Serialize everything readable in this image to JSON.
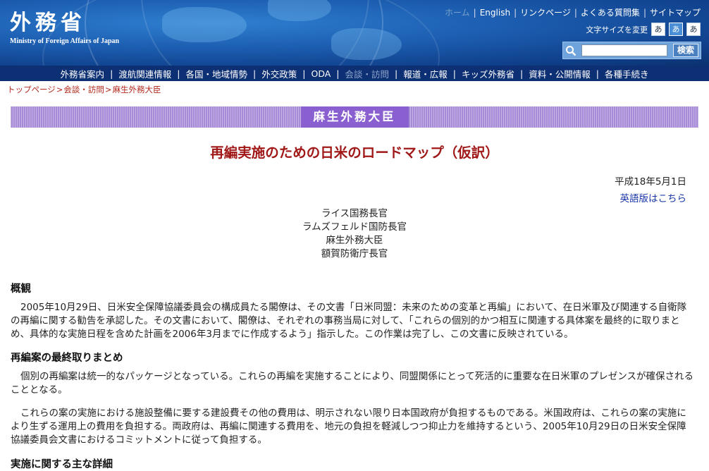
{
  "header": {
    "logo_ja": "外務省",
    "logo_en": "Ministry of Foreign Affairs of Japan",
    "util_links": [
      "English",
      "リンクページ",
      "よくある質問集",
      "サイトマップ"
    ],
    "util_dim": "ホーム",
    "font_size_label": "文字サイズを変更",
    "font_sizes": [
      "あ",
      "あ",
      "あ"
    ],
    "search_placeholder": "",
    "search_button": "検索"
  },
  "nav": {
    "items": [
      "外務省案内",
      "渡航関連情報",
      "各国・地域情勢",
      "外交政策",
      "ODA",
      "会談・訪問",
      "報道・広報",
      "キッズ外務省",
      "資料・公開情報",
      "各種手続き"
    ],
    "current_index": 5
  },
  "breadcrumb": [
    "トップページ",
    "会談・訪問",
    "麻生外務大臣"
  ],
  "section_title": "麻生外務大臣",
  "document": {
    "title": "再編実施のための日米のロードマップ（仮訳）",
    "date": "平成18年5月1日",
    "english_link": "英語版はこちら",
    "signatories": [
      "ライス国務長官",
      "ラムズフェルド国防長官",
      "麻生外務大臣",
      "額賀防衛庁長官"
    ],
    "h_overview": "概観",
    "p_overview": "2005年10月29日、日米安全保障協議委員会の構成員たる閣僚は、その文書「日米同盟：未来のための変革と再編」において、在日米軍及び関連する自衛隊の再編に関する勧告を承認した。その文書において、閣僚は、それぞれの事務当局に対して、「これらの個別的かつ相互に関連する具体案を最終的に取りまとめ、具体的な実施日程を含めた計画を2006年3月までに作成するよう」指示した。この作業は完了し、この文書に反映されている。",
    "h_final": "再編案の最終取りまとめ",
    "p_final_1": "個別の再編案は統一的なパッケージとなっている。これらの再編を実施することにより、同盟関係にとって死活的に重要な在日米軍のプレゼンスが確保されることとなる。",
    "p_final_2": "これらの案の実施における施設整備に要する建設費その他の費用は、明示されない限り日本国政府が負担するものである。米国政府は、これらの案の実施により生ずる運用上の費用を負担する。両政府は、再編に関連する費用を、地元の負担を軽減しつつ抑止力を維持するという、2005年10月29日の日米安全保障協議委員会文書におけるコミットメントに従って負担する。",
    "h_details": "実施に関する主な詳細"
  }
}
